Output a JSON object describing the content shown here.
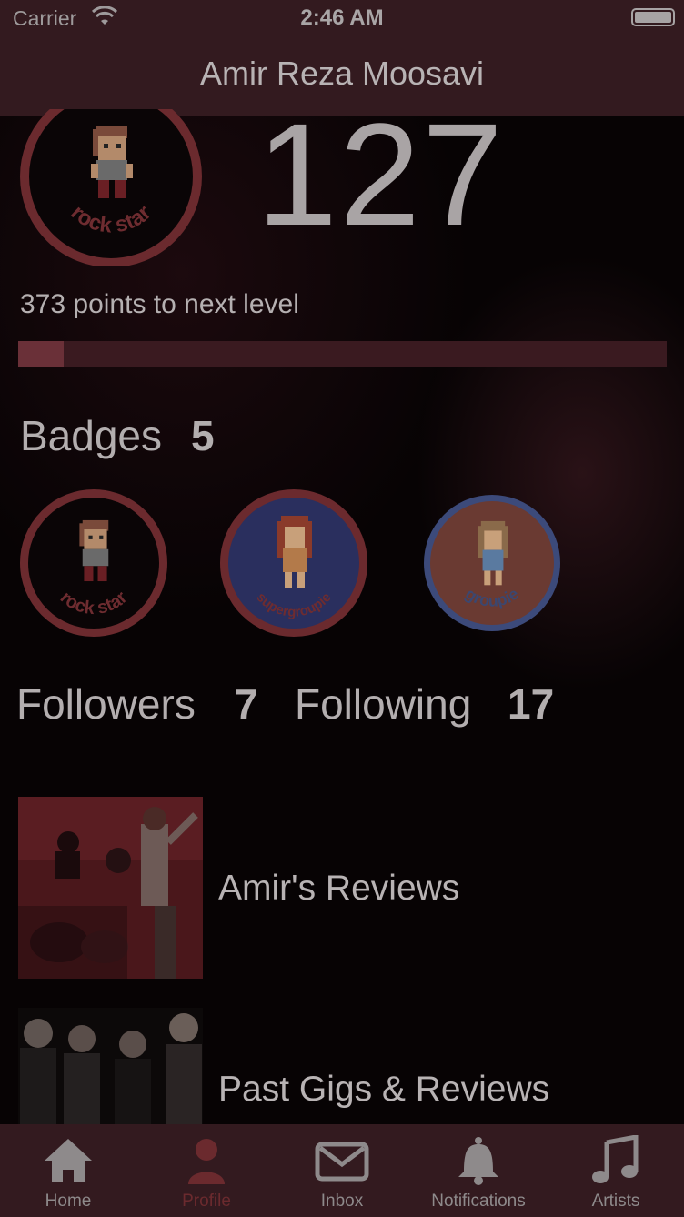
{
  "status_bar": {
    "carrier": "Carrier",
    "time": "2:46 AM"
  },
  "nav": {
    "title": "Amir Reza Moosavi"
  },
  "level": {
    "badge_label": "rock star",
    "score": "127",
    "points_text": "373 points to next level",
    "progress_fraction": 0.07
  },
  "badges": {
    "label": "Badges",
    "count": "5",
    "items": [
      {
        "label": "rock star",
        "ring_color": "#6b2a2e",
        "fill_color": "#0a0506",
        "text_color": "#6e2c30"
      },
      {
        "label": "supergroupie",
        "ring_color": "#6b2a2e",
        "fill_color": "#2a2f5e",
        "text_color": "#6e2c30"
      },
      {
        "label": "groupie",
        "ring_color": "#3c4a7a",
        "fill_color": "#6a3a32",
        "text_color": "#3b4770"
      }
    ]
  },
  "social": {
    "followers_label": "Followers",
    "followers_count": "7",
    "following_label": "Following",
    "following_count": "17"
  },
  "rows": [
    {
      "label": "Amir's Reviews"
    },
    {
      "label": "Past Gigs & Reviews"
    }
  ],
  "tabs": [
    {
      "label": "Home",
      "icon": "home-icon",
      "active": false
    },
    {
      "label": "Profile",
      "icon": "profile-icon",
      "active": true
    },
    {
      "label": "Inbox",
      "icon": "envelope-icon",
      "active": false
    },
    {
      "label": "Notifications",
      "icon": "bell-icon",
      "active": false
    },
    {
      "label": "Artists",
      "icon": "music-note-icon",
      "active": false
    }
  ],
  "colors": {
    "accent": "#6b2a2e",
    "bar_background": "#331a1f"
  }
}
